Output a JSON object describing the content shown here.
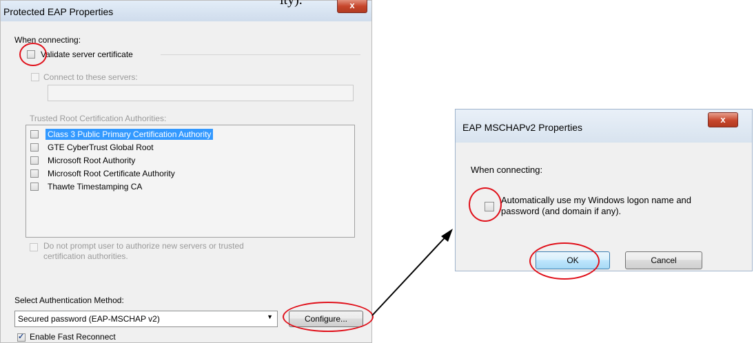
{
  "overlay": {
    "top_text": "ity)."
  },
  "left_dialog": {
    "title": "Protected EAP Properties",
    "close_glyph": "x",
    "when_connecting": "When connecting:",
    "validate_server_cert": "Validate server certificate",
    "connect_to_servers": "Connect to these servers:",
    "servers_value": "",
    "trusted_root_label": "Trusted Root Certification Authorities:",
    "ca_list": [
      "Class 3 Public Primary Certification Authority",
      "GTE CyberTrust Global Root",
      "Microsoft Root Authority",
      "Microsoft Root Certificate Authority",
      "Thawte Timestamping CA"
    ],
    "no_prompt_line1": "Do not prompt user to authorize new servers or trusted",
    "no_prompt_line2": "certification authorities.",
    "select_auth_label": "Select Authentication Method:",
    "auth_method_value": "Secured password (EAP-MSCHAP v2)",
    "configure_button": "Configure...",
    "enable_fast_reconnect": "Enable Fast Reconnect"
  },
  "right_dialog": {
    "title": "EAP MSCHAPv2 Properties",
    "close_glyph": "x",
    "when_connecting": "When connecting:",
    "auto_logon_line1": "Automatically use my Windows logon name and",
    "auto_logon_line2": "password (and domain if any).",
    "ok_button": "OK",
    "cancel_button": "Cancel"
  },
  "colors": {
    "highlight_ring": "#e0101a",
    "selection": "#3399ff",
    "close_button": "#c6462c"
  }
}
